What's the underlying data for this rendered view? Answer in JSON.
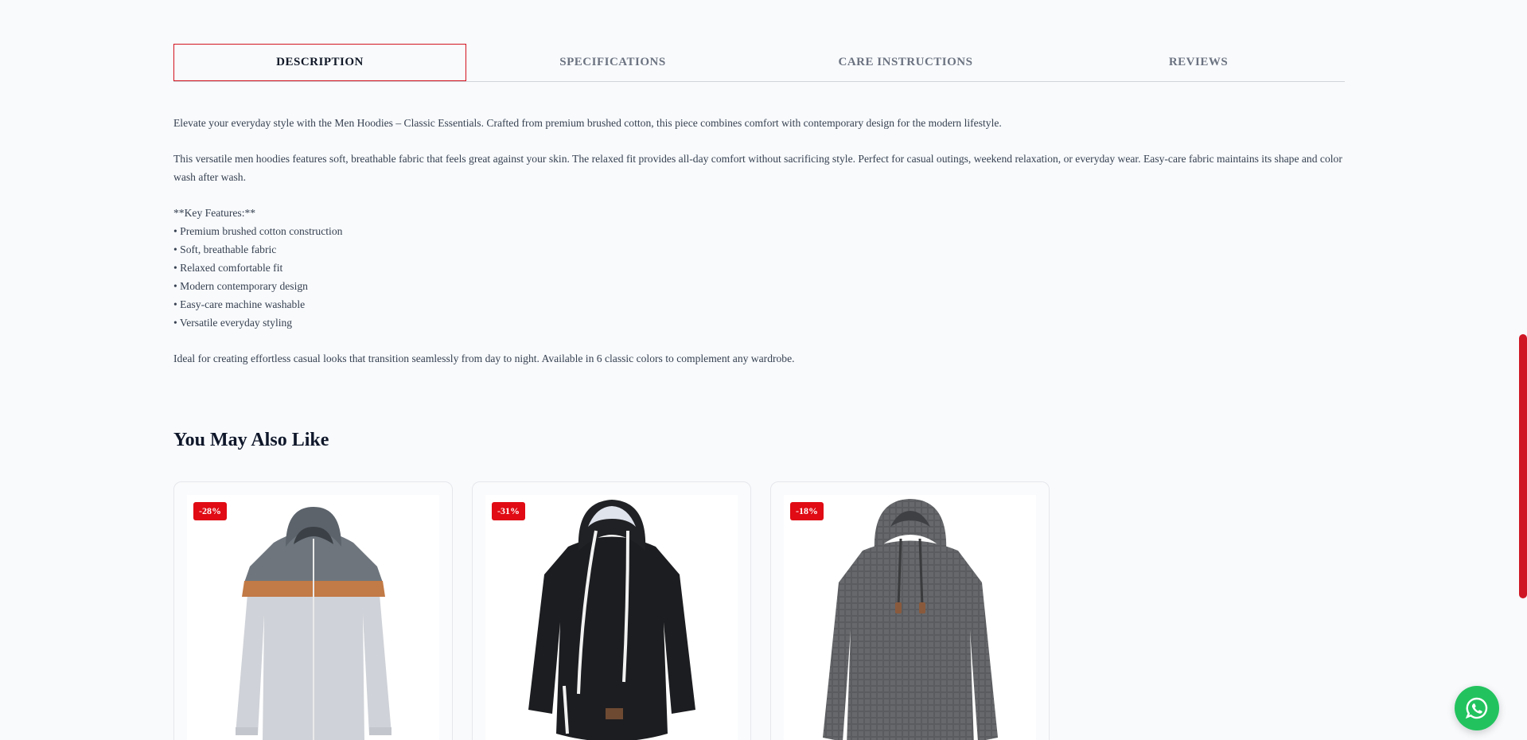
{
  "tabs": [
    {
      "label": "DESCRIPTION",
      "active": true
    },
    {
      "label": "SPECIFICATIONS",
      "active": false
    },
    {
      "label": "CARE INSTRUCTIONS",
      "active": false
    },
    {
      "label": "REVIEWS",
      "active": false
    }
  ],
  "description": {
    "intro": "Elevate your everyday style with the Men Hoodies – Classic Essentials. Crafted from premium brushed cotton, this piece combines comfort with contemporary design for the modern lifestyle.",
    "body": "This versatile men hoodies features soft, breathable fabric that feels great against your skin. The relaxed fit provides all-day comfort without sacrificing style. Perfect for casual outings, weekend relaxation, or everyday wear. Easy-care fabric maintains its shape and color wash after wash.",
    "features_heading": "**Key Features:**",
    "features": [
      "• Premium brushed cotton construction",
      "• Soft, breathable fabric",
      "• Relaxed comfortable fit",
      "• Modern contemporary design",
      "• Easy-care machine washable",
      "• Versatile everyday styling"
    ],
    "closing": "Ideal for creating effortless casual looks that transition seamlessly from day to night. Available in 6 classic colors to complement any wardrobe."
  },
  "related": {
    "title": "You May Also Like",
    "products": [
      {
        "badge": "-28%",
        "image": "grey-orange-zip-hoodie"
      },
      {
        "badge": "-31%",
        "image": "black-drawstring-hoodie"
      },
      {
        "badge": "-18%",
        "image": "charcoal-waffle-hoodie"
      }
    ]
  },
  "colors": {
    "accent": "#d4131f",
    "badge": "#e00b14",
    "whatsapp": "#22c35e"
  },
  "icons": {
    "chat": "whatsapp-icon"
  }
}
